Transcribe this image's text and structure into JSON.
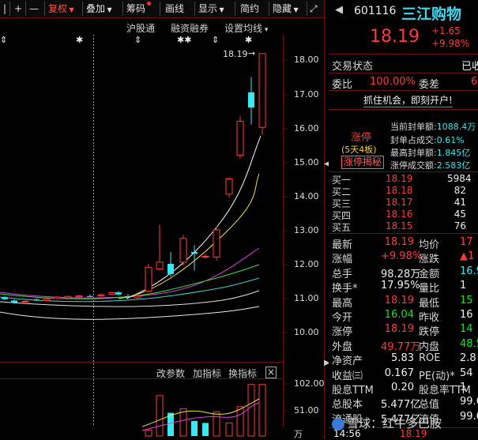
{
  "toolbar": {
    "items": [
      "|",
      "+",
      "—",
      "复权",
      "叠加",
      "筹码",
      "画线",
      "显示",
      "简约",
      "隐藏"
    ]
  },
  "chart_menu": {
    "items": [
      "沪股通",
      "融资融券",
      "设置均线"
    ]
  },
  "main_chart": {
    "last_price_tag": "18.19",
    "y_ticks": [
      "18.00",
      "17.00",
      "16.00",
      "15.00",
      "14.00",
      "13.00",
      "12.00",
      "11.00",
      "10.00"
    ]
  },
  "indicator_menu": {
    "items": [
      "改参数",
      "加指标",
      "换指标"
    ],
    "close": "×"
  },
  "vol_chart": {
    "y_ticks": [
      "102.00",
      "51.00",
      "万"
    ]
  },
  "colors": {
    "up": "#ff3b3b",
    "down": "#38e8f0",
    "ma5": "#ffffff",
    "ma10": "#f0e040",
    "ma20": "#e040e0",
    "ma30": "#40e040"
  },
  "quote": {
    "code": "601116",
    "name": "三江购物",
    "price": "18.19",
    "change": "+1.65",
    "change_pct": "+9.98%",
    "trade_status_label": "交易状态",
    "trade_status": "已收",
    "weibi_label": "委比",
    "weibi": "100.00%",
    "weicha_label": "委差",
    "weicha": "6",
    "banner": "抓住机会，即刻开户!",
    "limit_label": "涨停",
    "limit_sub": "(5天4板)",
    "limit_secret": "涨停揭秘",
    "limit_stats": [
      {
        "label": "当前封单额:",
        "value": "1088.4万"
      },
      {
        "label": "封单占成交:",
        "value": "0.61%"
      },
      {
        "label": "最高封单额:",
        "value": "1.845亿"
      },
      {
        "label": "涨停成交额:",
        "value": "2.583亿"
      }
    ],
    "bids": [
      {
        "label": "买一",
        "price": "18.19",
        "vol": "5984"
      },
      {
        "label": "买二",
        "price": "18.18",
        "vol": "82"
      },
      {
        "label": "买三",
        "price": "18.17",
        "vol": "41"
      },
      {
        "label": "买四",
        "price": "18.16",
        "vol": "45"
      },
      {
        "label": "买五",
        "price": "18.15",
        "vol": "76"
      }
    ],
    "stats": [
      {
        "l1": "最新",
        "v1": "18.19",
        "c1": "red",
        "l2": "均价",
        "v2": "17",
        "c2": "red"
      },
      {
        "l1": "涨幅",
        "v1": "+9.98%",
        "c1": "red",
        "l2": "涨跌",
        "v2": "▲1",
        "c2": "red"
      },
      {
        "l1": "总手",
        "v1": "98.28万",
        "c1": "white",
        "l2": "金额",
        "v2": "16.9",
        "c2": "cyan"
      },
      {
        "l1": "换手*",
        "v1": "17.95%",
        "c1": "white",
        "l2": "量比",
        "v2": "1",
        "c2": "white"
      },
      {
        "l1": "最高",
        "v1": "18.19",
        "c1": "red",
        "l2": "最低",
        "v2": "15",
        "c2": "green"
      },
      {
        "l1": "今开",
        "v1": "16.04",
        "c1": "green",
        "l2": "昨收",
        "v2": "16",
        "c2": "white"
      },
      {
        "l1": "涨停",
        "v1": "18.19",
        "c1": "red",
        "l2": "跌停",
        "v2": "14",
        "c2": "green"
      },
      {
        "l1": "外盘",
        "v1": "49.77万",
        "c1": "red",
        "l2": "内盘",
        "v2": "48.5",
        "c2": "green"
      },
      {
        "l1": "净资产",
        "v1": "5.83",
        "c1": "white",
        "l2": "ROE",
        "v2": "2.8",
        "c2": "white"
      },
      {
        "l1": "收益㈢",
        "v1": "0.167",
        "c1": "white",
        "l2": "PE(动)*",
        "v2": "54",
        "c2": "white"
      },
      {
        "l1": "股息TTM",
        "v1": "0.20",
        "c1": "white",
        "l2": "股息率TTM",
        "v2": "1",
        "c2": "white"
      },
      {
        "l1": "总股本",
        "v1": "5.477亿",
        "c1": "white",
        "l2": "总值",
        "v2": "99.6",
        "c2": "white"
      },
      {
        "l1": "流通股",
        "v1": "5.477亿",
        "c1": "white",
        "l2": "流值",
        "v2": "99.6",
        "c2": "white"
      }
    ],
    "tick_time": "14:56",
    "tick_price": "18.19"
  },
  "watermark": "雪球：红牛多巴胺"
}
